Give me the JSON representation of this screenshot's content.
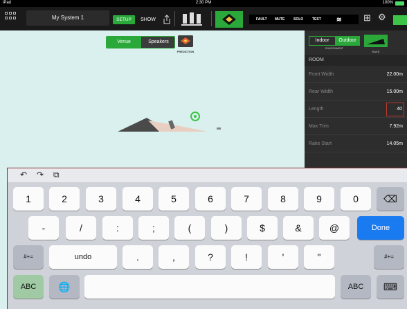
{
  "status_bar": {
    "device": "iPad",
    "time": "2:30 PM",
    "battery": "100%"
  },
  "toolbar": {
    "system_name": "My System 1",
    "setup_label": "SETUP",
    "show_label": "SHOW",
    "fault_label": "FAULT",
    "mute_label": "MUTE",
    "solo_label": "SOLO",
    "test_label": "TEST"
  },
  "view_tabs": {
    "venue": "Venue",
    "speakers": "Speakers",
    "prediction": "PREDICTION"
  },
  "panel": {
    "indoor": "Indoor",
    "outdoor": "Outdoor",
    "environment_label": "ENVIRONMENT",
    "rake_label": "RAKE",
    "section": "ROOM",
    "rows": [
      {
        "key": "Front Width",
        "value": "22.00m"
      },
      {
        "key": "Rear Width",
        "value": "15.00m"
      },
      {
        "key": "Length",
        "value": "40"
      },
      {
        "key": "Max Trim",
        "value": "7.92m"
      },
      {
        "key": "Rake Start",
        "value": "14.05m"
      }
    ]
  },
  "keyboard": {
    "shortcuts": [
      "↶",
      "↷",
      "⧉"
    ],
    "row1": [
      "1",
      "2",
      "3",
      "4",
      "5",
      "6",
      "7",
      "8",
      "9",
      "0"
    ],
    "backspace": "⌫",
    "row2": [
      "-",
      "/",
      ":",
      ";",
      "(",
      ")",
      "$",
      "&",
      "@"
    ],
    "done": "Done",
    "more_left": "#+=",
    "undo": "undo",
    "row3": [
      ".",
      ",",
      "?",
      "!",
      "'",
      "\""
    ],
    "more_right": "#+=",
    "abc_left": "ABC",
    "globe": "🌐",
    "abc_right": "ABC",
    "hide": "⌨"
  },
  "colors": {
    "accent": "#2aa83a",
    "done": "#1a7bf0",
    "highlight": "#c0392b"
  }
}
